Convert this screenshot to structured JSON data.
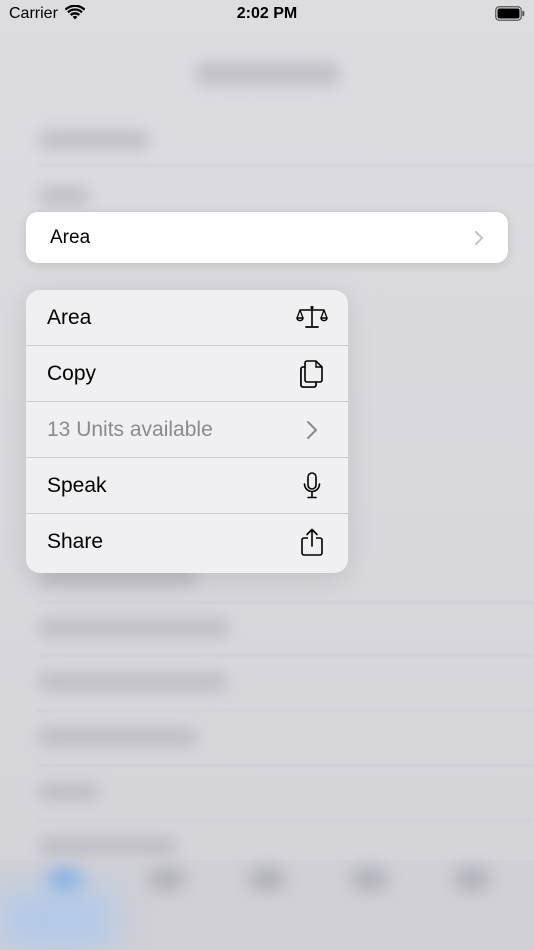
{
  "status_bar": {
    "carrier": "Carrier",
    "time": "2:02 PM",
    "icons": [
      "wifi-icon",
      "battery-icon"
    ]
  },
  "preview_row": {
    "label": "Area",
    "icon": "chevron-right-icon"
  },
  "context_menu": {
    "items": [
      {
        "label": "Area",
        "icon": "scale-icon",
        "enabled": true
      },
      {
        "label": "Copy",
        "icon": "copy-icon",
        "enabled": true
      },
      {
        "label": "13 Units available",
        "icon": "chevron-right-icon",
        "enabled": false
      },
      {
        "label": "Speak",
        "icon": "microphone-icon",
        "enabled": true
      },
      {
        "label": "Share",
        "icon": "share-icon",
        "enabled": true
      }
    ]
  },
  "colors": {
    "menu_background": "#f0f0f2",
    "disabled_text": "#8a8a8e",
    "tab_active": "#8ab4e6"
  }
}
